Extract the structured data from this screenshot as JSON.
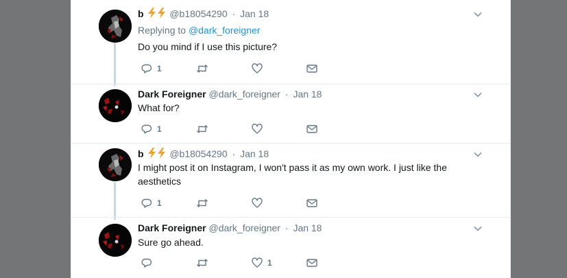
{
  "tweets": [
    {
      "name": "b",
      "badge": "⚡⚡",
      "handle": "@b18054290",
      "date": "Jan 18",
      "replying_prefix": "Replying to",
      "replying_to": "@dark_foreigner",
      "text": "Do you mind if I use this picture?",
      "reply_count": "1",
      "retweet_count": "",
      "like_count": ""
    },
    {
      "name": "Dark Foreigner",
      "handle": "@dark_foreigner",
      "date": "Jan 18",
      "text": "What for?",
      "reply_count": "1",
      "retweet_count": "",
      "like_count": ""
    },
    {
      "name": "b",
      "badge": "⚡⚡",
      "handle": "@b18054290",
      "date": "Jan 18",
      "text": "I might post it on Instagram, I won't pass it as my own work. I just like the aesthetics",
      "reply_count": "1",
      "retweet_count": "",
      "like_count": ""
    },
    {
      "name": "Dark Foreigner",
      "handle": "@dark_foreigner",
      "date": "Jan 18",
      "text": "Sure go ahead.",
      "reply_count": "",
      "retweet_count": "",
      "like_count": "1"
    }
  ],
  "separator": "·",
  "icons": {
    "reply": "reply-icon",
    "retweet": "retweet-icon",
    "like": "heart-icon",
    "message": "envelope-icon",
    "caret": "chevron-down-icon",
    "badge": "lightning-icon"
  },
  "colors": {
    "page_background": "#747576",
    "panel": "#ffffff",
    "text": "#14171a",
    "secondary": "#657786",
    "link": "#1b95e0",
    "badge": "#f4a41c",
    "thread_line": "#ccd6dd"
  }
}
